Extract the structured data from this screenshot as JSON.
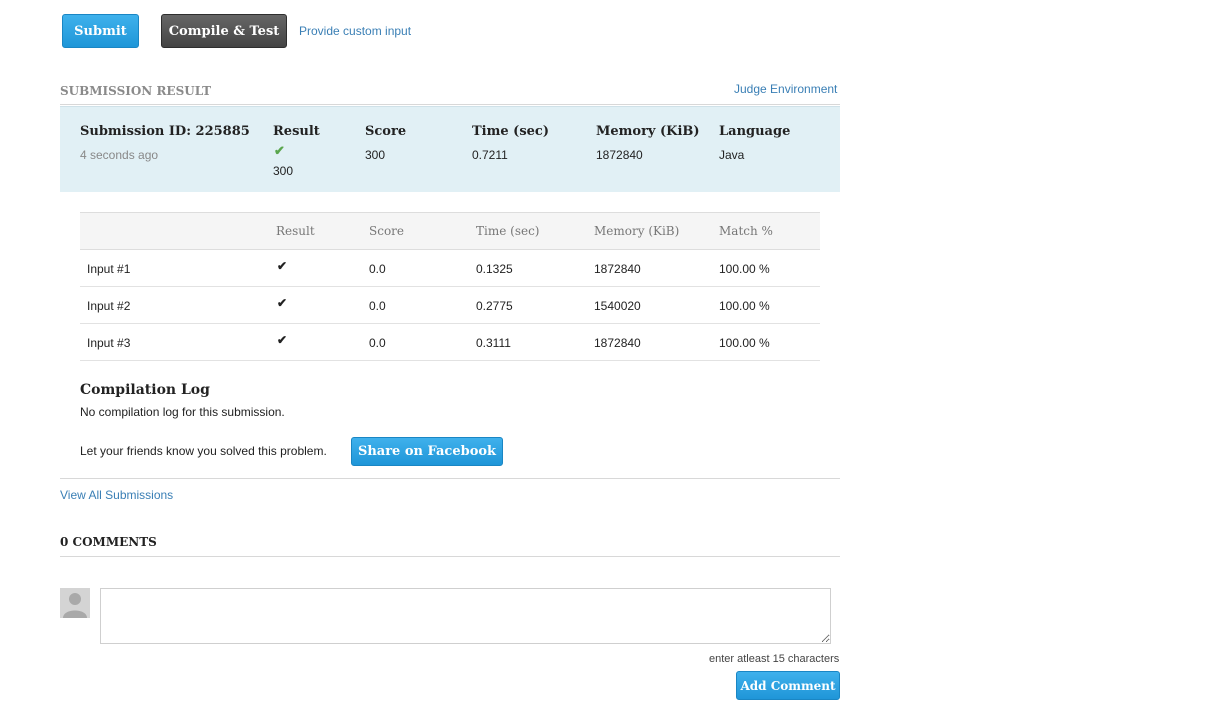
{
  "toolbar": {
    "submit_label": "Submit",
    "compile_label": "Compile & Test",
    "custom_input_label": "Provide custom input"
  },
  "result_section": {
    "title": "SUBMISSION RESULT",
    "judge_env_label": "Judge Environment"
  },
  "summary": {
    "submission_id": "Submission ID: 225885",
    "time_ago": "4 seconds ago",
    "result_header": "Result",
    "result_score": "300",
    "score_header": "Score",
    "score_value": "300",
    "time_header": "Time (sec)",
    "time_value": "0.7211",
    "memory_header": "Memory (KiB)",
    "memory_value": "1872840",
    "language_header": "Language",
    "language_value": "Java"
  },
  "tests": {
    "headers": [
      "Result",
      "Score",
      "Time (sec)",
      "Memory (KiB)",
      "Match %"
    ],
    "rows": [
      {
        "name": "Input #1",
        "score": "0.0",
        "time": "0.1325",
        "memory": "1872840",
        "match": "100.00 %"
      },
      {
        "name": "Input #2",
        "score": "0.0",
        "time": "0.2775",
        "memory": "1540020",
        "match": "100.00 %"
      },
      {
        "name": "Input #3",
        "score": "0.0",
        "time": "0.3111",
        "memory": "1872840",
        "match": "100.00 %"
      }
    ]
  },
  "compilation": {
    "title": "Compilation Log",
    "message": "No compilation log for this submission."
  },
  "share": {
    "text": "Let your friends know you solved this problem.",
    "button_label": "Share on Facebook"
  },
  "view_all_label": "View All Submissions",
  "comments": {
    "title": "0 COMMENTS",
    "hint": "enter atleast 15 characters",
    "add_label": "Add Comment",
    "textarea_value": ""
  },
  "colors": {
    "accent_blue": "#2ba3e3",
    "summary_bg": "#e1f0f5",
    "check_green": "#5aa64d",
    "link": "#3a7fb5"
  },
  "icons": {
    "check": "check-icon",
    "avatar": "avatar-placeholder-icon"
  }
}
